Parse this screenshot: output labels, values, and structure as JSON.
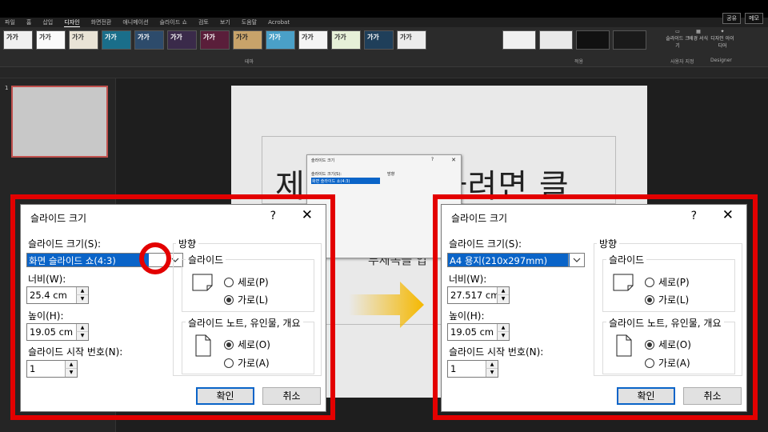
{
  "ribbon": {
    "tabs": [
      "파일",
      "홈",
      "삽입",
      "디자인",
      "화면전환",
      "애니메이션",
      "슬라이드 쇼",
      "검토",
      "보기",
      "도움말",
      "Acrobat"
    ],
    "active_tab": "디자인",
    "share": "공유",
    "comments": "메모",
    "theme_sample": "가가",
    "themes_group": "테마",
    "variants_group": "적용",
    "customize_group": "사용자 지정",
    "designer_group": "Designer",
    "slide_size_btn": "슬라이드 크기",
    "format_bg_btn": "배경 서식",
    "design_ideas_btn": "디자인 아이디어"
  },
  "thumbs": {
    "number": "1"
  },
  "slide": {
    "title": "제목을 추가하려면 클",
    "subtitle": "부제목을 입"
  },
  "mini_dialog": {
    "title": "슬라이드 크기",
    "size_label": "슬라이드 크기(S):",
    "size_value": "화면 슬라이드 쇼(4:3)",
    "orient": "방향"
  },
  "dialog_left": {
    "title": "슬라이드 크기",
    "help": "?",
    "close": "✕",
    "size_label": "슬라이드 크기(S):",
    "size_value": "화면 슬라이드 쇼(4:3)",
    "width_label": "너비(W):",
    "width_value": "25.4 cm",
    "height_label": "높이(H):",
    "height_value": "19.05 cm",
    "start_label": "슬라이드 시작 번호(N):",
    "start_value": "1",
    "orientation": "방향",
    "slide_group": "슬라이드",
    "portrait": "세로(P)",
    "landscape": "가로(L)",
    "notes_group": "슬라이드 노트, 유인물, 개요",
    "notes_portrait": "세로(O)",
    "notes_landscape": "가로(A)",
    "ok": "확인",
    "cancel": "취소"
  },
  "dialog_right": {
    "title": "슬라이드 크기",
    "help": "?",
    "close": "✕",
    "size_label": "슬라이드 크기(S):",
    "size_value": "A4 용지(210x297mm)",
    "width_label": "너비(W):",
    "width_value": "27.517 cm",
    "height_label": "높이(H):",
    "height_value": "19.05 cm",
    "start_label": "슬라이드 시작 번호(N):",
    "start_value": "1",
    "orientation": "방향",
    "slide_group": "슬라이드",
    "portrait": "세로(P)",
    "landscape": "가로(L)",
    "notes_group": "슬라이드 노트, 유인물, 개요",
    "notes_portrait": "세로(O)",
    "notes_landscape": "가로(A)",
    "ok": "확인",
    "cancel": "취소"
  },
  "colors": {
    "highlight": "#e30000",
    "arrow": "#f5b800",
    "selection": "#0a64c8"
  }
}
